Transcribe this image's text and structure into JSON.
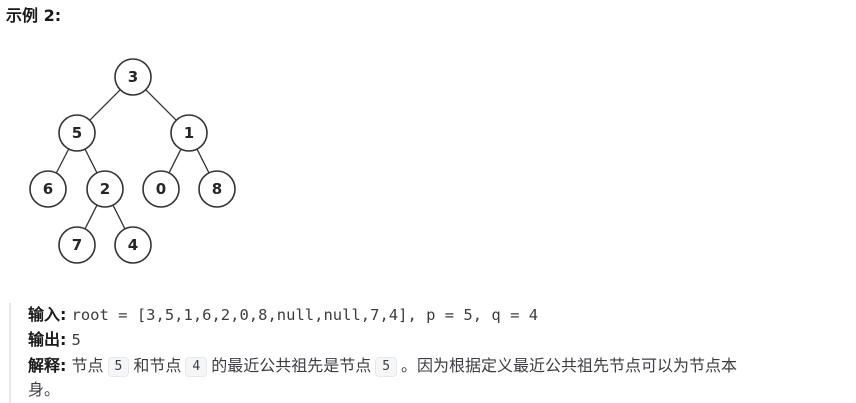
{
  "heading": "示例 2:",
  "tree": {
    "nodes": [
      {
        "id": "n3",
        "value": "3"
      },
      {
        "id": "n5",
        "value": "5"
      },
      {
        "id": "n1",
        "value": "1"
      },
      {
        "id": "n6",
        "value": "6"
      },
      {
        "id": "n2",
        "value": "2"
      },
      {
        "id": "n0",
        "value": "0"
      },
      {
        "id": "n8",
        "value": "8"
      },
      {
        "id": "n7",
        "value": "7"
      },
      {
        "id": "n4",
        "value": "4"
      }
    ],
    "edges": [
      [
        "n3",
        "n5"
      ],
      [
        "n3",
        "n1"
      ],
      [
        "n5",
        "n6"
      ],
      [
        "n5",
        "n2"
      ],
      [
        "n1",
        "n0"
      ],
      [
        "n1",
        "n8"
      ],
      [
        "n2",
        "n7"
      ],
      [
        "n2",
        "n4"
      ]
    ]
  },
  "example": {
    "input_label": "输入:",
    "input_value": "root = [3,5,1,6,2,0,8,null,null,7,4], p = 5, q = 4",
    "output_label": "输出:",
    "output_value": "5",
    "explanation_label": "解释:",
    "explanation_part1": "节点",
    "explanation_code1": "5",
    "explanation_part2": "和节点",
    "explanation_code2": "4",
    "explanation_part3": "的最近公共祖先是节点",
    "explanation_code3": "5",
    "explanation_part4": "。因为根据定义最近公共祖先节点可以为节点本",
    "explanation_part5": "身。"
  }
}
